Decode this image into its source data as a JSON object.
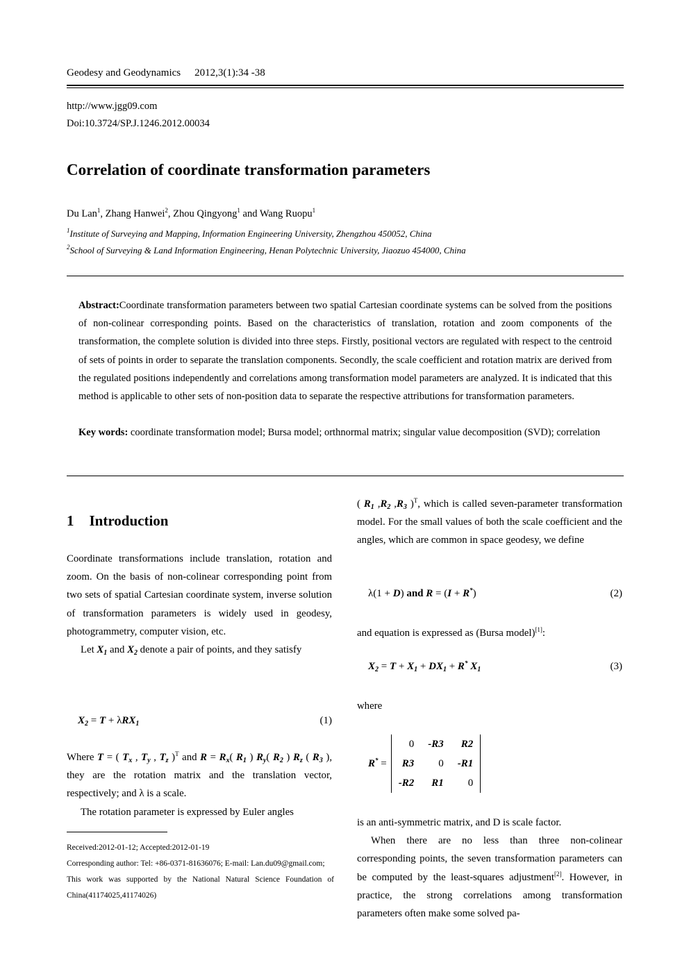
{
  "header": {
    "journal": "Geodesy and Geodynamics",
    "citation": "2012,3(1):34 -38",
    "url": "http://www.jgg09.com",
    "doi": "Doi:10.3724/SP.J.1246.2012.00034"
  },
  "title": "Correlation of coordinate transformation parameters",
  "authors": [
    {
      "name": "Du Lan",
      "aff": "1",
      "sep": ", "
    },
    {
      "name": "Zhang Hanwei",
      "aff": "2",
      "sep": ", "
    },
    {
      "name": "Zhou Qingyong",
      "aff": "1",
      "sep": " and "
    },
    {
      "name": "Wang Ruopu",
      "aff": "1",
      "sep": ""
    }
  ],
  "affiliations": [
    {
      "num": "1",
      "text": "Institute of Surveying and Mapping, Information Engineering University, Zhengzhou 450052, China"
    },
    {
      "num": "2",
      "text": "School of Surveying & Land Information Engineering, Henan Polytechnic University, Jiaozuo 454000, China"
    }
  ],
  "abstract": {
    "label": "Abstract:",
    "text": "Coordinate transformation parameters between two spatial Cartesian coordinate systems can be solved from the positions of non-colinear corresponding points. Based on the characteristics of translation, rotation and zoom components of the transformation, the complete solution is divided into three steps. Firstly, positional vectors are regulated with respect to the centroid of sets of points in order to separate the translation components. Secondly, the scale coefficient and rotation matrix are derived from the regulated positions independently and correlations among transformation model parameters are analyzed. It is indicated that this method is applicable to other sets of non-position data to separate the respective attributions for transformation parameters.",
    "keywords_label": "Key words:",
    "keywords": "coordinate transformation model; Bursa model; orthnormal matrix; singular value decomposition (SVD); correlation"
  },
  "section1": {
    "number": "1",
    "title": "Introduction",
    "para1": "Coordinate transformations include translation, rotation and zoom. On the basis of non-colinear corresponding point from two sets of spatial Cartesian coordinate system, inverse solution of transformation parameters is widely used in geodesy, photogrammetry, computer vision, etc.",
    "para2_a": "Let ",
    "para2_b": " and ",
    "para2_c": " denote a pair of points, and they satisfy",
    "eq1": {
      "lhs": "X",
      "rest": " = T + λRX",
      "num": "(1)"
    },
    "para3_where": "Where ",
    "para3_T": "T = (T",
    "para3_mid": " and ",
    "para3_R": "R = R",
    "para3_tail": ", they are the rotation matrix and the translation vector, respectively; and λ is a scale.",
    "para4": "The rotation parameter is expressed by Euler angles"
  },
  "right": {
    "para1_tail": ", which is called seven-parameter transformation model. For the small values of both the scale coefficient and the angles, which are common in space geodesy, we define",
    "eq2": {
      "text_a": "λ(1 + ",
      "D": "D",
      "text_b": ") and ",
      "R": "R",
      "text_c": " = (",
      "I": "I",
      "text_d": " + ",
      "Rstar": "R",
      "text_e": ")",
      "num": "(2)"
    },
    "para2": "and equation is expressed as (Bursa model)",
    "para2_ref": "[1]",
    "para2_end": ":",
    "eq3": {
      "num": "(3)"
    },
    "where": "where",
    "matrix": {
      "lhs": "R",
      "rows": [
        [
          "0",
          "-R3",
          "R2"
        ],
        [
          "R3",
          "0",
          "-R1"
        ],
        [
          "-R2",
          "R1",
          "0"
        ]
      ]
    },
    "para3": "is an anti-symmetric matrix, and D is scale factor.",
    "para4": "When there are no less than three non-colinear corresponding points, the seven transformation parameters can be computed by the least-squares adjustment",
    "para4_ref": "[2]",
    "para4_tail": ". However, in practice, the strong correlations among transformation parameters often make some solved pa-"
  },
  "footnotes": {
    "received": "Received:2012-01-12; Accepted:2012-01-19",
    "corresponding": "Corresponding author: Tel: +86-0371-81636076; E-mail: Lan.du09@gmail.com;",
    "funding": "This work was supported by the National Natural Science Foundation of China(41174025,41174026)"
  }
}
